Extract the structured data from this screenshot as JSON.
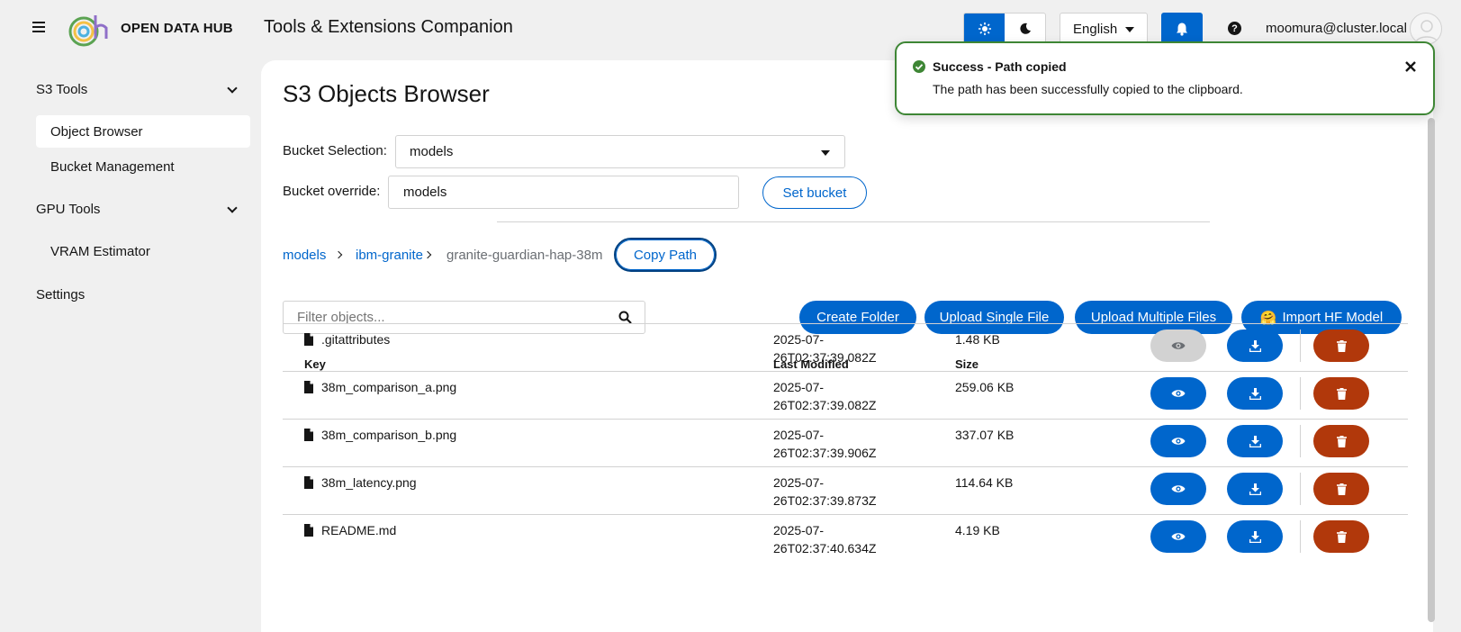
{
  "header": {
    "brand_strong": "OPEN",
    "brand_light": "DATA HUB",
    "app_title": "Tools & Extensions Companion",
    "language": "English",
    "help_symbol": "?",
    "username": "moomura@cluster.local"
  },
  "sidebar": {
    "groups": [
      {
        "label": "S3 Tools",
        "items": [
          {
            "label": "Object Browser",
            "active": true
          },
          {
            "label": "Bucket Management"
          }
        ]
      },
      {
        "label": "GPU Tools",
        "items": [
          {
            "label": "VRAM Estimator"
          }
        ]
      }
    ],
    "settings_label": "Settings"
  },
  "main": {
    "title": "S3 Objects Browser",
    "bucket_selection_label": "Bucket Selection:",
    "bucket_selection_value": "models",
    "bucket_override_label": "Bucket override:",
    "bucket_override_value": "models",
    "set_bucket_label": "Set bucket",
    "breadcrumb": [
      "models",
      "ibm-granite",
      "granite-guardian-hap-38m"
    ],
    "copy_path_label": "Copy Path",
    "filter_placeholder": "Filter objects...",
    "actions": {
      "create_folder": "Create Folder",
      "upload_single": "Upload Single File",
      "upload_multiple": "Upload Multiple Files",
      "import_hf": "Import HF Model",
      "import_hf_emoji": "🤗"
    },
    "table": {
      "headers": [
        "Key",
        "Last Modified",
        "Size"
      ],
      "rows": [
        {
          "key": ".gitattributes",
          "modified_1": "2025-07-",
          "modified_2": "26T02:37:39.082Z",
          "size": "1.48 KB",
          "view_disabled": true
        },
        {
          "key": "38m_comparison_a.png",
          "modified_1": "2025-07-",
          "modified_2": "26T02:37:39.082Z",
          "size": "259.06 KB",
          "view_disabled": false
        },
        {
          "key": "38m_comparison_b.png",
          "modified_1": "2025-07-",
          "modified_2": "26T02:37:39.906Z",
          "size": "337.07 KB",
          "view_disabled": false
        },
        {
          "key": "38m_latency.png",
          "modified_1": "2025-07-",
          "modified_2": "26T02:37:39.873Z",
          "size": "114.64 KB",
          "view_disabled": false
        },
        {
          "key": "README.md",
          "modified_1": "2025-07-",
          "modified_2": "26T02:37:40.634Z",
          "size": "4.19 KB",
          "view_disabled": false
        }
      ]
    }
  },
  "toast": {
    "title": "Success - Path copied",
    "message": "The path has been successfully copied to the clipboard."
  },
  "colors": {
    "primary": "#0066cc",
    "danger": "#b1380b",
    "success": "#3e8635"
  },
  "icons": [
    "hamburger-icon",
    "sun-icon",
    "moon-icon",
    "bell-icon",
    "help-icon",
    "search-icon",
    "file-icon",
    "eye-icon",
    "download-icon",
    "trash-icon",
    "check-circle-icon",
    "close-icon"
  ]
}
